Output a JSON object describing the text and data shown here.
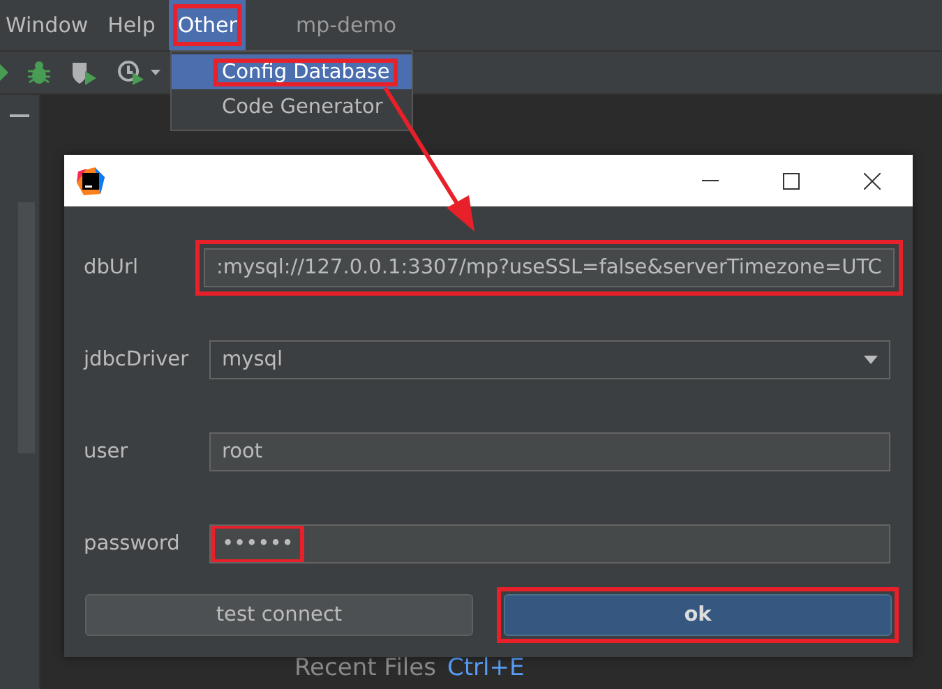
{
  "menu_bar": [
    {
      "label": "Window",
      "selected": false,
      "highlighted": false
    },
    {
      "label": "Help",
      "selected": false,
      "highlighted": false
    },
    {
      "label": "Other",
      "selected": true,
      "highlighted": true
    }
  ],
  "project_title": "mp-demo",
  "dropdown_menu": [
    {
      "label": "Config Database",
      "selected": true,
      "highlighted": true
    },
    {
      "label": "Code Generator",
      "selected": false,
      "highlighted": false
    }
  ],
  "dialog": {
    "fields": [
      {
        "label": "dbUrl",
        "kind": "text",
        "value": ":mysql://127.0.0.1:3307/mp?useSSL=false&serverTimezone=UTC",
        "highlighted": true
      },
      {
        "label": "jdbcDriver",
        "kind": "select",
        "value": "mysql",
        "highlighted": false
      },
      {
        "label": "user",
        "kind": "text",
        "value": "root",
        "highlighted": false
      },
      {
        "label": "password",
        "kind": "text",
        "value": "••••••",
        "highlighted": true
      }
    ],
    "buttons": [
      {
        "label": "test connect",
        "kind": "default",
        "highlighted": false
      },
      {
        "label": "ok",
        "kind": "primary",
        "highlighted": true
      }
    ]
  },
  "background_hint": {
    "label": "Recent Files",
    "shortcut": "Ctrl+E"
  }
}
